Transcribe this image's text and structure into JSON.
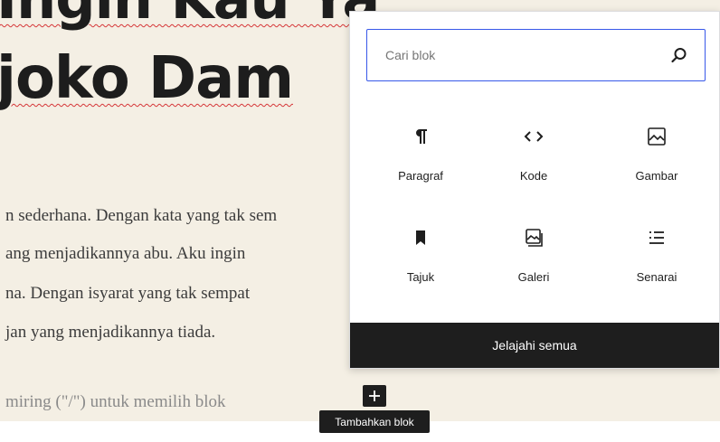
{
  "editor": {
    "heading_line_1": "Ingin Kau Ya",
    "heading_line_2": "joko Dam",
    "paragraph_lines": [
      "n sederhana. Dengan kata yang tak sem",
      "ang menjadikannya abu. Aku ingin",
      "na. Dengan isyarat yang tak sempat",
      "jan yang menjadikannya tiada."
    ],
    "placeholder_text": "miring (\"/\") untuk memilih blok"
  },
  "inserter": {
    "search_placeholder": "Cari blok",
    "search_icon": "search-icon",
    "blocks": [
      {
        "label": "Paragraf",
        "icon": "paragraph-icon"
      },
      {
        "label": "Kode",
        "icon": "code-icon"
      },
      {
        "label": "Gambar",
        "icon": "image-icon"
      },
      {
        "label": "Tajuk",
        "icon": "bookmark-icon"
      },
      {
        "label": "Galeri",
        "icon": "gallery-icon"
      },
      {
        "label": "Senarai",
        "icon": "list-icon"
      }
    ],
    "browse_all_label": "Jelajahi semua"
  },
  "add_block": {
    "icon": "plus-icon",
    "tooltip": "Tambahkan blok"
  },
  "colors": {
    "editor_background": "#f4efe4",
    "accent": "#3858e9",
    "dark": "#1e1e1e",
    "spelling_underline": "#d63638"
  }
}
